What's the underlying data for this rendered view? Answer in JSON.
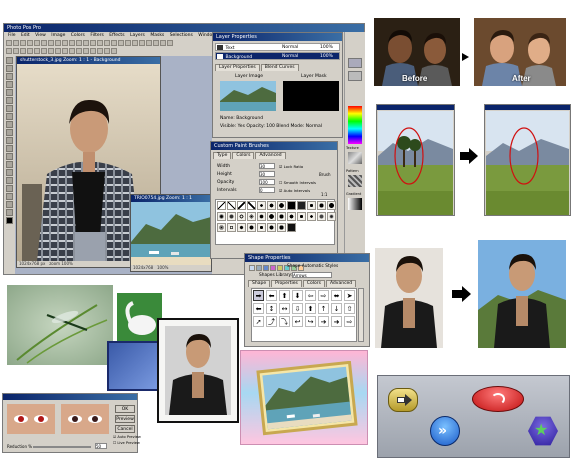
{
  "app": {
    "title": "Photo Pos Pro",
    "menu": [
      "File",
      "Edit",
      "View",
      "Image",
      "Colors",
      "Filters",
      "Effects",
      "Layers",
      "Masks",
      "Selections",
      "Window",
      "Help"
    ]
  },
  "doc1": {
    "title": "shutterstock_3.jpg  Zoom: 1 : 1 - Background",
    "status_left": "1024x768 px",
    "status_right": "zoom 100%"
  },
  "doc2": {
    "title": "TRIO0754.jpg  Zoom: 1 : 1",
    "status_left": "1024x768",
    "status_right": "100%"
  },
  "layers": {
    "title": "Layer Properties",
    "rows": [
      {
        "name": "Text",
        "mode": "Normal",
        "value": "100%"
      },
      {
        "name": "Background",
        "mode": "Normal",
        "value": "100%"
      }
    ],
    "tabs": [
      "Layer Properties",
      "Blend Curves"
    ],
    "img_label": "Layer Image",
    "mask_label": "Layer Mask",
    "name_line": "Name:  Background",
    "info_line": "Visible: Yes   Opacity: 100   Blend Mode: Normal"
  },
  "brushes": {
    "title": "Custom Paint Brushes",
    "tabs": [
      "Type",
      "Colors",
      "Advanced"
    ],
    "fields": [
      {
        "label": "Width",
        "value": "30"
      },
      {
        "label": "Height",
        "value": "30"
      },
      {
        "label": "Opacity",
        "value": "100"
      },
      {
        "label": "Intervals",
        "value": "0"
      }
    ],
    "checks": [
      "Lock Ratio",
      "Smooth Intervals",
      "Auto Intervals"
    ],
    "brush_label": "Brush",
    "brush_value": "1:1"
  },
  "shapes": {
    "title": "Shape Properties",
    "subtitle": "Shape Automatic Styles",
    "library": "Shapes Library:",
    "library_value": "Arrows",
    "tabs": [
      "Shape",
      "Properties",
      "Colors",
      "Advanced"
    ],
    "glyphs": [
      "➡",
      "⬅",
      "⬆",
      "⬇",
      "⇦",
      "⇨",
      "⬌",
      "➤",
      "⬅",
      "↕",
      "↔",
      "⇩",
      "⬆",
      "↑",
      "↓",
      "⇧",
      "➚",
      "⤴",
      "⤵",
      "↩",
      "↪",
      "➔",
      "➜",
      "⇨"
    ]
  },
  "right_panel": {
    "labels": [
      "Texture",
      "Pattern",
      "Gradient"
    ]
  },
  "dialog": {
    "buttons": [
      "OK",
      "Preview",
      "Cancel"
    ],
    "checks": [
      "Auto Preview",
      "Live Preview"
    ],
    "reduction_label": "Reduction %",
    "reduction_value": "50"
  },
  "captions": {
    "before": "Before",
    "after": "After"
  },
  "colors": {
    "titlebar": "#0a246a",
    "panel": "#d4d0c8",
    "workspace": "#a9b2c6"
  }
}
